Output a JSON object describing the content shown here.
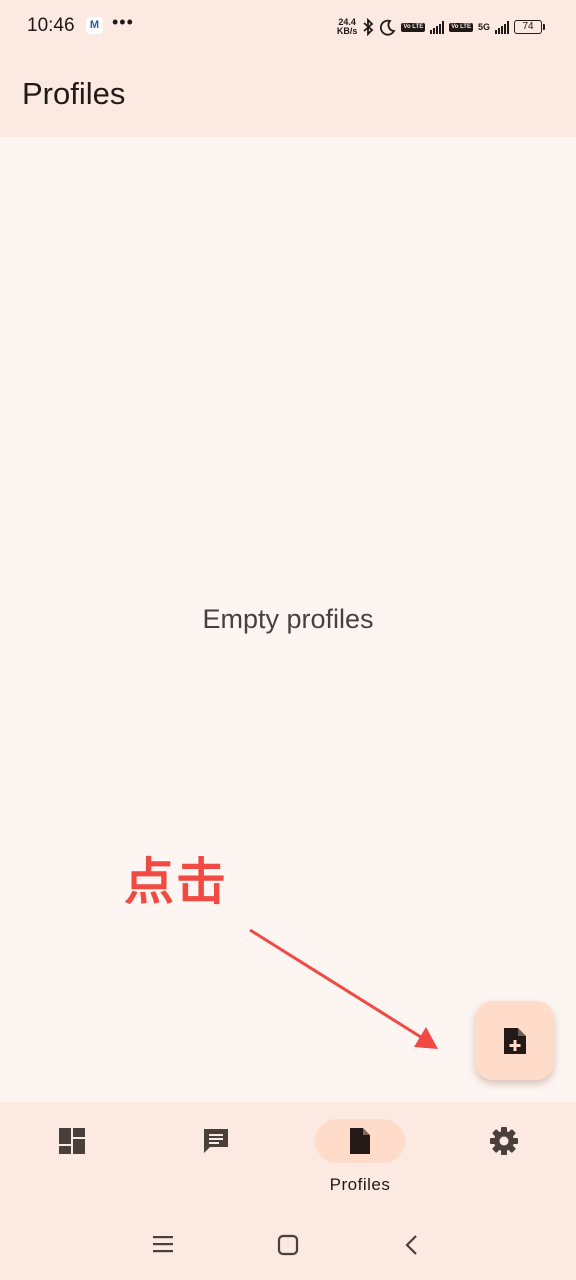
{
  "status_bar": {
    "time": "10:46",
    "app_badge": "M",
    "more": "•••",
    "net_speed_value": "24.4",
    "net_speed_unit": "KB/s",
    "volte1": "Vo LTE",
    "volte2": "Vo LTE",
    "network_type": "5G",
    "battery": "74"
  },
  "app_bar": {
    "title": "Profiles"
  },
  "content": {
    "empty_message": "Empty profiles"
  },
  "annotation": {
    "text": "点击",
    "color": "#f04a43"
  },
  "fab": {
    "icon": "new-file-icon"
  },
  "bottom_nav": {
    "items": [
      {
        "icon": "dashboard-icon",
        "label": ""
      },
      {
        "icon": "message-icon",
        "label": ""
      },
      {
        "icon": "file-icon",
        "label": "Profiles",
        "active": true
      },
      {
        "icon": "settings-icon",
        "label": ""
      }
    ]
  },
  "system_nav": {
    "icons": [
      "menu-icon",
      "home-icon",
      "back-icon"
    ]
  },
  "colors": {
    "background": "#fdf5f2",
    "surface": "#fbe9e2",
    "accent_container": "#ffdbc9",
    "on_surface": "#231a17"
  }
}
